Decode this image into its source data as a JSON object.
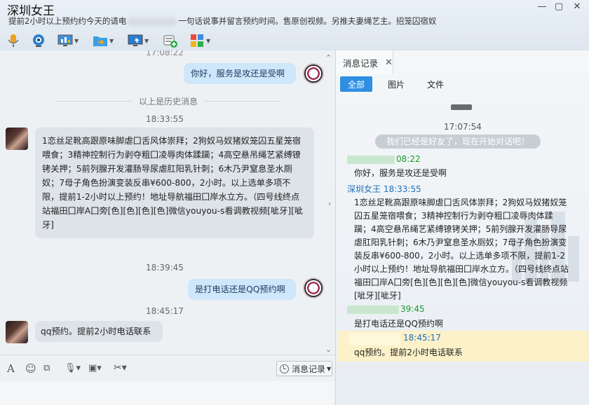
{
  "window": {
    "title": "深圳女王",
    "subtitle_start": "提前2小时以上预约约今天的请电",
    "subtitle_end": "一句话说事并留言预约时间。售原创视频。另推夫妻绳艺主。招笼囚宿奴",
    "controls": [
      "—",
      "▢",
      "✕"
    ]
  },
  "toolbar": {
    "icons": [
      "microphone-icon",
      "video-camera-icon",
      "screen-share-icon",
      "file-transfer-icon",
      "remote-desktop-icon",
      "add-app-icon",
      "apps-grid-icon"
    ]
  },
  "chat": {
    "top_time_partial": "17:08:22",
    "history_divider": "以上是历史消息",
    "messages": [
      {
        "dir": "out",
        "text": "你好，服务是攻还是受啊"
      },
      {
        "dir": "time",
        "text": "18:33:55"
      },
      {
        "dir": "in",
        "text": "1恋丝足靴高跟原味脚虐囗舌风体崇拜；2狗奴马奴猪奴笼囚五星笼宿喂食；3精神控制行为剥夺粗囗凌辱肉体蹂躏；4高空悬吊绳艺紧缚镣铐关押；5前列腺开发灌肠导尿虐肛阳乳针刺；6木乃尹窒息圣水厕奴；7母子角色扮演变装反串¥600-800，2小时。以上选单多项不限，提前1-2小时以上预约！地址导航福田囗岸水立方。（四号线终点站福田囗岸A囗旁[色][色][色][色]微信youyou-s看调教视频[呲牙][呲牙]"
      },
      {
        "dir": "time",
        "text": "18:39:45"
      },
      {
        "dir": "out",
        "text": "是打电话还是QQ预约啊"
      },
      {
        "dir": "time",
        "text": "18:45:17"
      },
      {
        "dir": "in",
        "text": "qq预约。提前2小时电话联系"
      }
    ]
  },
  "input_toolbar": {
    "icons": [
      "font-icon",
      "emoji-icon",
      "screenshot-icon",
      "voice-icon",
      "image-icon",
      "scissors-icon"
    ],
    "history_button": "消息记录"
  },
  "panel": {
    "tab_label": "消息记录",
    "tab_close": "✕",
    "filters": [
      "全部",
      "图片",
      "文件"
    ],
    "date_time": "17:07:54",
    "friend_notice": "我们已经是好友了，现在开始对话吧！",
    "entries": [
      {
        "sender": "",
        "time": "08:22",
        "type": "me",
        "text": "你好，服务是攻还是受啊"
      },
      {
        "sender": "深圳女王",
        "time": "18:33:55",
        "type": "them",
        "text": "1恋丝足靴高跟原味脚虐囗舌风体崇拜；2狗奴马奴猪奴笼囚五星笼宿喂食；3精神控制行为剥夺粗囗凌辱肉体蹂躏；4高空悬吊绳艺紧缚镣铐关押；5前列腺开发灌肠导尿虐肛阳乳针刺；6木乃尹窒息圣水厕奴；7母子角色扮演变装反串¥600-800，2小时。以上选单多项不限，提前1-2小时以上预约！地址导航福田囗岸水立方。（四号线终点站福田囗岸A囗旁[色][色][色][色]微信youyou-s看调教视频[呲牙][呲牙]"
      },
      {
        "sender": "",
        "time": "39:45",
        "type": "me",
        "text": "是打电话还是QQ预约啊"
      },
      {
        "sender": "",
        "time": "18:45:17",
        "type": "them",
        "text": "qq预约。提前2小时电话联系"
      }
    ]
  }
}
